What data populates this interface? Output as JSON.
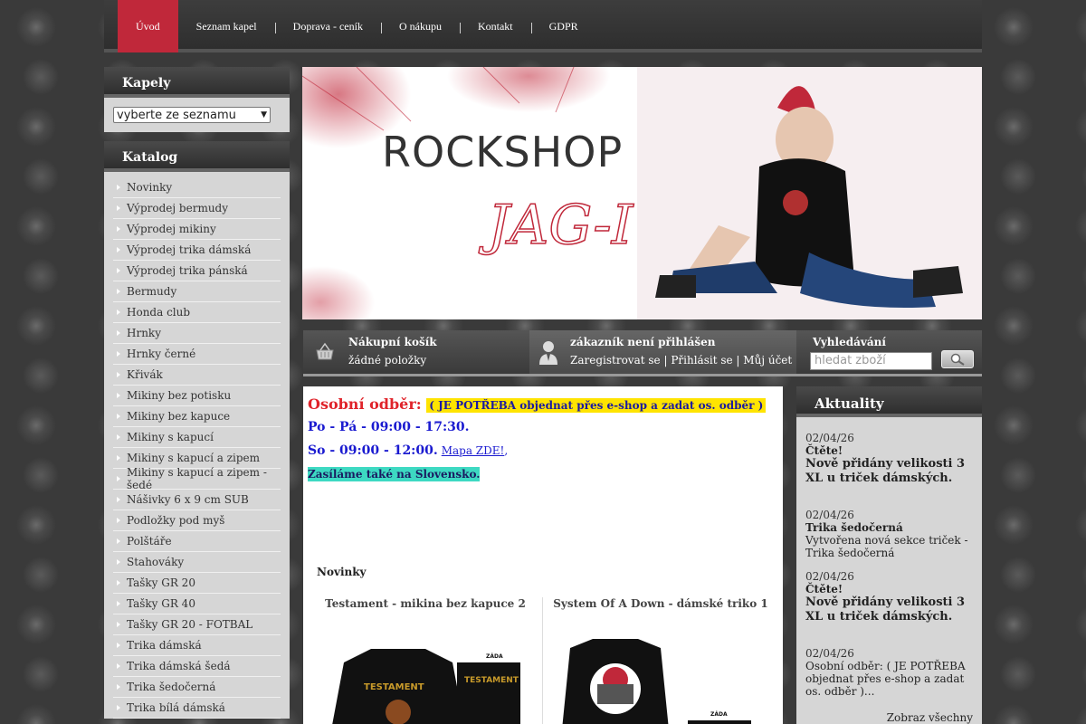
{
  "nav": {
    "items": [
      "Úvod",
      "Seznam kapel",
      "Doprava - ceník",
      "O nákupu",
      "Kontakt",
      "GDPR"
    ]
  },
  "left": {
    "kapely_title": "Kapely",
    "kapely_select": "vyberte ze seznamu",
    "katalog_title": "Katalog",
    "categories": [
      "Novinky",
      "Výprodej bermudy",
      "Výprodej mikiny",
      "Výprodej trika dámská",
      "Výprodej trika pánská",
      "Bermudy",
      "Honda club",
      "Hrnky",
      "Hrnky černé",
      "Křivák",
      "Mikiny bez potisku",
      "Mikiny bez kapuce",
      "Mikiny s kapucí",
      "Mikiny s kapucí a zipem",
      "Mikiny s kapucí a zipem - šedé",
      "Nášivky 6 x 9 cm SUB",
      "Podložky pod myš",
      "Polštáře",
      "Stahováky",
      "Tašky GR 20",
      "Tašky GR 40",
      "Tašky GR 20 - FOTBAL",
      "Trika dámská",
      "Trika dámská šedá",
      "Trika šedočerná",
      "Trika bílá dámská"
    ]
  },
  "banner": {
    "title": "ROCKSHOP",
    "script": "JAG-I"
  },
  "bar": {
    "cart_title": "Nákupní košík",
    "cart_status": "žádné položky",
    "user_title": "zákazník není přihlášen",
    "user_register": "Zaregistrovat se",
    "user_login": "Přihlásit se",
    "user_account": "Můj účet",
    "sep": "|",
    "search_title": "Vyhledávání",
    "search_placeholder": "hledat zboží"
  },
  "main": {
    "pickup_label": "Osobní odběr:",
    "pickup_note": "( JE POTŘEBA objednat přes e-shop a zadat os. odběr )",
    "hours_weekday": "Po - Pá - 09:00 - 17:30.",
    "hours_sat": "So - 09:00 - 12:00",
    "map_link": "Mapa ZDE!",
    "slovakia": "Zasíláme také na Slovensko.",
    "novinky": "Novinky",
    "products": [
      {
        "name": "Testament - mikina bez kapuce 2",
        "back_label": "ZÁDA",
        "print": "TESTAMENT"
      },
      {
        "name": "System Of A Down - dámské triko 1",
        "back_label": "ZÁDA"
      }
    ]
  },
  "right": {
    "title": "Aktuality",
    "news": [
      {
        "date": "02/04/26",
        "title": "Čtěte!",
        "text": "Nově přidány velikosti 3 XL u triček dámských."
      },
      {
        "date": "02/04/26",
        "title": "Trika šedočerná",
        "text": "Vytvořena nová sekce triček - Trika šedočerná"
      },
      {
        "date": "02/04/26",
        "title": "Čtěte!",
        "text": "Nově přidány velikosti 3 XL u triček dámských."
      },
      {
        "date": "02/04/26",
        "title": "",
        "text": "Osobní odběr:  ( JE POTŘEBA objednat přes e-shop a zadat os. odběr )..."
      }
    ],
    "more": "Zobraz všechny"
  },
  "colors": {
    "accent": "#c0283a",
    "panel": "#d6d6d6",
    "highlight_yellow": "#ffe400",
    "highlight_teal": "#3dd9c2"
  }
}
